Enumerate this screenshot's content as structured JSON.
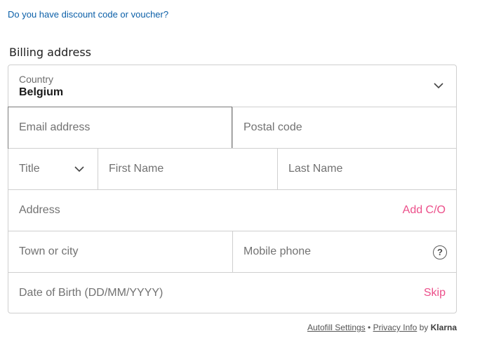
{
  "discount": {
    "link_text": "Do you have discount code or voucher?"
  },
  "billing": {
    "title": "Billing address",
    "country": {
      "label": "Country",
      "value": "Belgium"
    },
    "email": {
      "placeholder": "Email address"
    },
    "postal_code": {
      "placeholder": "Postal code"
    },
    "title_select": {
      "placeholder": "Title"
    },
    "first_name": {
      "placeholder": "First Name"
    },
    "last_name": {
      "placeholder": "Last Name"
    },
    "address": {
      "placeholder": "Address",
      "action": "Add C/O"
    },
    "town": {
      "placeholder": "Town or city"
    },
    "mobile_phone": {
      "placeholder": "Mobile phone",
      "help": "?"
    },
    "dob": {
      "placeholder": "Date of Birth (DD/MM/YYYY)",
      "action": "Skip"
    }
  },
  "footer": {
    "autofill": "Autofill Settings",
    "separator": "•",
    "privacy": "Privacy Info",
    "by": "by",
    "brand": "Klarna"
  },
  "colors": {
    "link": "#0b5fa8",
    "accent": "#ec4f8a",
    "border": "#cfcfcf"
  },
  "icons": {
    "dropdown": "chevron-down-icon",
    "help": "question-circle-icon"
  }
}
